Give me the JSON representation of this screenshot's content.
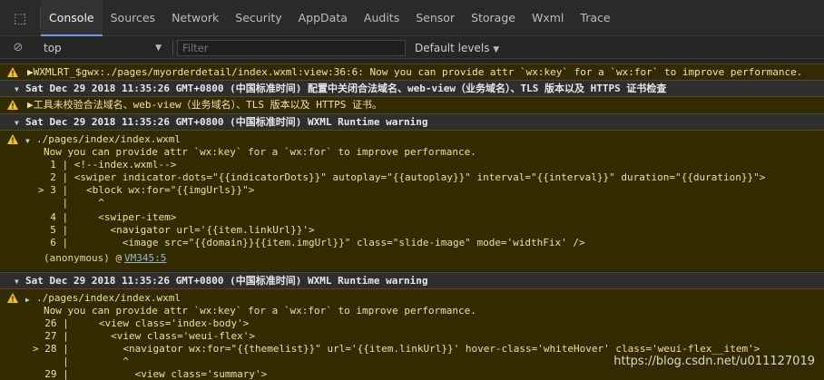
{
  "tabs": [
    "Console",
    "Sources",
    "Network",
    "Security",
    "AppData",
    "Audits",
    "Sensor",
    "Storage",
    "Wxml",
    "Trace"
  ],
  "toolbar": {
    "context": "top",
    "filter_placeholder": "Filter",
    "levels": "Default levels"
  },
  "rows": {
    "r1": "▶WXMLRT_$gwx:./pages/myorderdetail/index.wxml:view:36:6: Now you can provide attr `wx:key` for a `wx:for` to improve performance.",
    "g1": "Sat Dec 29 2018 11:35:26 GMT+0800 (中国标准时间) 配置中关闭合法域名、web-view（业务域名）、TLS 版本以及 HTTPS 证书检查",
    "r2": "▶工具未校验合法域名、web-view（业务域名）、TLS 版本以及 HTTPS 证书。",
    "g2": "Sat Dec 29 2018 11:35:26 GMT+0800 (中国标准时间) WXML Runtime warning",
    "g3": "Sat Dec 29 2018 11:35:26 GMT+0800 (中国标准时间) WXML Runtime warning"
  },
  "block1": {
    "file": "./pages/index/index.wxml",
    "lines": [
      "Now you can provide attr `wx:key` for a `wx:for` to improve performance.",
      "  1 | <!--index.wxml-->",
      "  2 | <swiper indicator-dots=\"{{indicatorDots}}\" autoplay=\"{{autoplay}}\" interval=\"{{interval}}\" duration=\"{{duration}}\">",
      "> 3 |   <block wx:for=\"{{imgUrls}}\">",
      "    |     ^",
      "  4 |     <swiper-item>",
      "  5 |       <navigator url='{{item.linkUrl}}'>",
      "  6 |         <image src=\"{{domain}}{{item.imgUrl}}\" class=\"slide-image\" mode='widthFix' />"
    ],
    "anon": "(anonymous) @ ",
    "link": "VM345:5"
  },
  "block2": {
    "file": "./pages/index/index.wxml",
    "lines": [
      "Now you can provide attr `wx:key` for a `wx:for` to improve performance.",
      "  26 |     <view class='index-body'>",
      "  27 |       <view class='weui-flex'>",
      "> 28 |         <navigator wx:for=\"{{themelist}}\" url='{{item.linkUrl}}' hover-class='whiteHover' class='weui-flex__item'>",
      "     |         ^",
      "  29 |           <view class='summary'>"
    ]
  },
  "watermark": "https://blog.csdn.net/u011127019"
}
